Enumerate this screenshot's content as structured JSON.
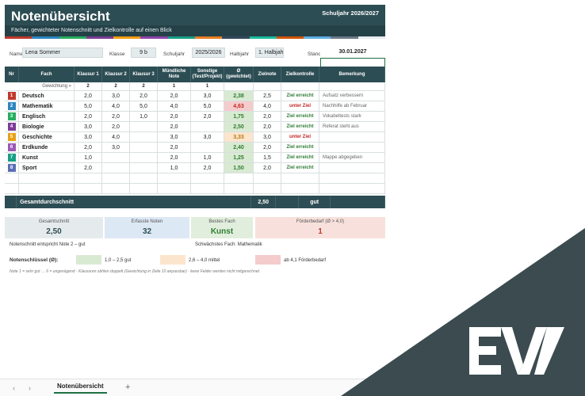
{
  "header": {
    "title": "Notenübersicht",
    "year": "Schuljahr 2026/2027",
    "subtitle": "Fächer, gewichteter Notenschnitt und Zielkontrolle auf einen Blick",
    "strip_colors": [
      "#c0392b",
      "#2e86c1",
      "#27ae60",
      "#7d3c98",
      "#f39c12",
      "#8e44ad",
      "#16a085",
      "#e67e22",
      "#34495e",
      "#1abc9c",
      "#d35400",
      "#5dade2",
      "#6c7a89",
      "#e9ecef"
    ]
  },
  "info": {
    "name_label": "Name",
    "name_value": "Lena Sommer",
    "klasse_label": "Klasse",
    "klasse_value": "9 b",
    "schuljahr_label": "Schuljahr",
    "schuljahr_value": "2025/2026",
    "halbjahr_label": "Halbjahr",
    "halbjahr_value": "1. Halbjahr",
    "stand_label": "Stand",
    "stand_value": "30.01.2027"
  },
  "table": {
    "headers": [
      "Nr",
      "Fach",
      "Klausur 1",
      "Klausur 2",
      "Klausur 3",
      "Mündliche Note",
      "Sonstige (Test/Projekt)",
      "Ø (gewichtet)",
      "Zielnote",
      "Zielkontrolle",
      "Bemerkung"
    ],
    "weight_label": "Gewichtung »",
    "weights": [
      "2",
      "2",
      "2",
      "1",
      "1"
    ],
    "rows": [
      {
        "nr": "1",
        "color": "#c0392b",
        "fach": "Deutsch",
        "k1": "2,0",
        "k2": "3,0",
        "k3": "2,0",
        "mn": "2,0",
        "st": "3,0",
        "avg": "2,38",
        "avg_bg": "#d9ead3",
        "zn": "2,5",
        "zk": "Ziel erreicht",
        "zk_color": "#2e7d32",
        "bem": "Aufsatz verbessern"
      },
      {
        "nr": "2",
        "color": "#2e86c1",
        "fach": "Mathematik",
        "k1": "5,0",
        "k2": "4,0",
        "k3": "5,0",
        "mn": "4,0",
        "st": "5,0",
        "avg": "4,63",
        "avg_bg": "#f4cccc",
        "zn": "4,0",
        "zk": "unter Ziel",
        "zk_color": "#c62828",
        "bem": "Nachhilfe ab Februar"
      },
      {
        "nr": "3",
        "color": "#27ae60",
        "fach": "Englisch",
        "k1": "2,0",
        "k2": "2,0",
        "k3": "1,0",
        "mn": "2,0",
        "st": "2,0",
        "avg": "1,75",
        "avg_bg": "#d9ead3",
        "zn": "2,0",
        "zk": "Ziel erreicht",
        "zk_color": "#2e7d32",
        "bem": "Vokabeltests stark"
      },
      {
        "nr": "4",
        "color": "#7d3c98",
        "fach": "Biologie",
        "k1": "3,0",
        "k2": "2,0",
        "k3": "",
        "mn": "2,0",
        "st": "",
        "avg": "2,50",
        "avg_bg": "#d9ead3",
        "zn": "2,0",
        "zk": "Ziel erreicht",
        "zk_color": "#2e7d32",
        "bem": "Referat steht aus"
      },
      {
        "nr": "5",
        "color": "#e6a117",
        "fach": "Geschichte",
        "k1": "3,0",
        "k2": "4,0",
        "k3": "",
        "mn": "3,0",
        "st": "3,0",
        "avg": "3,33",
        "avg_bg": "#fce5cd",
        "zn": "3,0",
        "zk": "unter Ziel",
        "zk_color": "#c62828",
        "bem": ""
      },
      {
        "nr": "6",
        "color": "#9b59b6",
        "fach": "Erdkunde",
        "k1": "2,0",
        "k2": "3,0",
        "k3": "",
        "mn": "2,0",
        "st": "",
        "avg": "2,40",
        "avg_bg": "#d9ead3",
        "zn": "2,0",
        "zk": "Ziel erreicht",
        "zk_color": "#2e7d32",
        "bem": ""
      },
      {
        "nr": "7",
        "color": "#16a085",
        "fach": "Kunst",
        "k1": "1,0",
        "k2": "",
        "k3": "",
        "mn": "2,0",
        "st": "1,0",
        "avg": "1,25",
        "avg_bg": "#d9ead3",
        "zn": "1,5",
        "zk": "Ziel erreicht",
        "zk_color": "#2e7d32",
        "bem": "Mappe abgegeben"
      },
      {
        "nr": "8",
        "color": "#5b6fb5",
        "fach": "Sport",
        "k1": "2,0",
        "k2": "",
        "k3": "",
        "mn": "1,0",
        "st": "2,0",
        "avg": "1,50",
        "avg_bg": "#d9ead3",
        "zn": "2,0",
        "zk": "Ziel erreicht",
        "zk_color": "#2e7d32",
        "bem": ""
      }
    ],
    "total_label": "Gesamtdurchschnitt",
    "total_avg": "2,50",
    "total_grade": "gut"
  },
  "kpis": [
    {
      "label": "Gesamtschnitt",
      "value": "2,50",
      "bg": "#e5ebec",
      "color": "#2d4d54"
    },
    {
      "label": "Erfasste Noten",
      "value": "32",
      "bg": "#dde8f5",
      "color": "#2d4d54"
    },
    {
      "label": "Bestes Fach",
      "value": "Kunst",
      "bg": "#e2eedd",
      "color": "#2e7d32"
    },
    {
      "label": "Förderbedarf (Ø > 4,0)",
      "value": "1",
      "bg": "#f8e1dc",
      "color": "#c0392b"
    }
  ],
  "notes": {
    "left": "Notenschnitt entspricht Note 2 – gut",
    "right": "Schwächstes Fach: Mathematik"
  },
  "legend": {
    "label": "Notenschlüssel (Ø):",
    "items": [
      {
        "color": "#d9ead3",
        "text": "1,0 – 2,5  gut"
      },
      {
        "color": "#fce5cd",
        "text": "2,6 – 4,0  mittel"
      },
      {
        "color": "#f4cccc",
        "text": "ab 4,1  Förderbedarf"
      }
    ],
    "footnote": "Note 1 = sehr gut … 6 = ungenügend · Klausuren zählen doppelt (Gewichtung in Zeile 10 anpassbar) · leere Felder werden nicht mitgerechnet."
  },
  "tabs": {
    "active": "Notenübersicht",
    "add": "+",
    "prev": "‹",
    "next": "›"
  },
  "overlay": {
    "color": "#3b4b50",
    "logo": "EV"
  }
}
